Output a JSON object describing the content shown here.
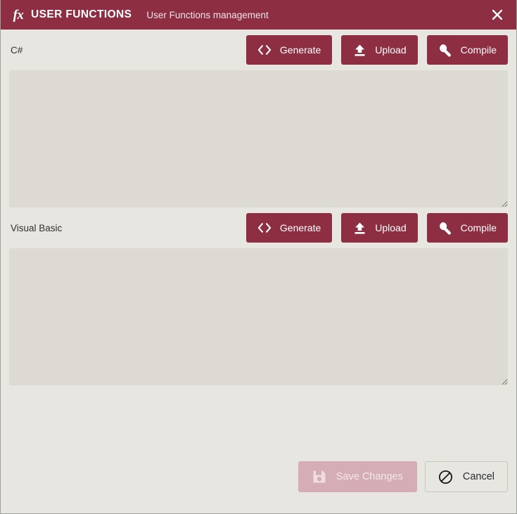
{
  "window": {
    "accent_color": "#8d2e43",
    "background_color": "#e8e6e0",
    "editor_background_color": "#dcdad3"
  },
  "titlebar": {
    "icon": "fx-icon",
    "icon_glyph": "fx",
    "title": "USER FUNCTIONS",
    "subtitle": "User Functions management",
    "close_icon": "close-icon"
  },
  "sections": [
    {
      "label": "C#",
      "editor_value": "",
      "editor_placeholder": "",
      "buttons": [
        {
          "label": "Generate",
          "icon": "code-brackets-icon"
        },
        {
          "label": "Upload",
          "icon": "upload-icon"
        },
        {
          "label": "Compile",
          "icon": "wrench-icon"
        }
      ]
    },
    {
      "label": "Visual Basic",
      "editor_value": "",
      "editor_placeholder": "",
      "buttons": [
        {
          "label": "Generate",
          "icon": "code-brackets-icon"
        },
        {
          "label": "Upload",
          "icon": "upload-icon"
        },
        {
          "label": "Compile",
          "icon": "wrench-icon"
        }
      ]
    }
  ],
  "footer": {
    "save": {
      "label": "Save Changes",
      "icon": "save-floppy-icon",
      "enabled": false,
      "color": "#d4aeb4"
    },
    "cancel": {
      "label": "Cancel",
      "icon": "no-entry-icon",
      "enabled": true
    }
  }
}
